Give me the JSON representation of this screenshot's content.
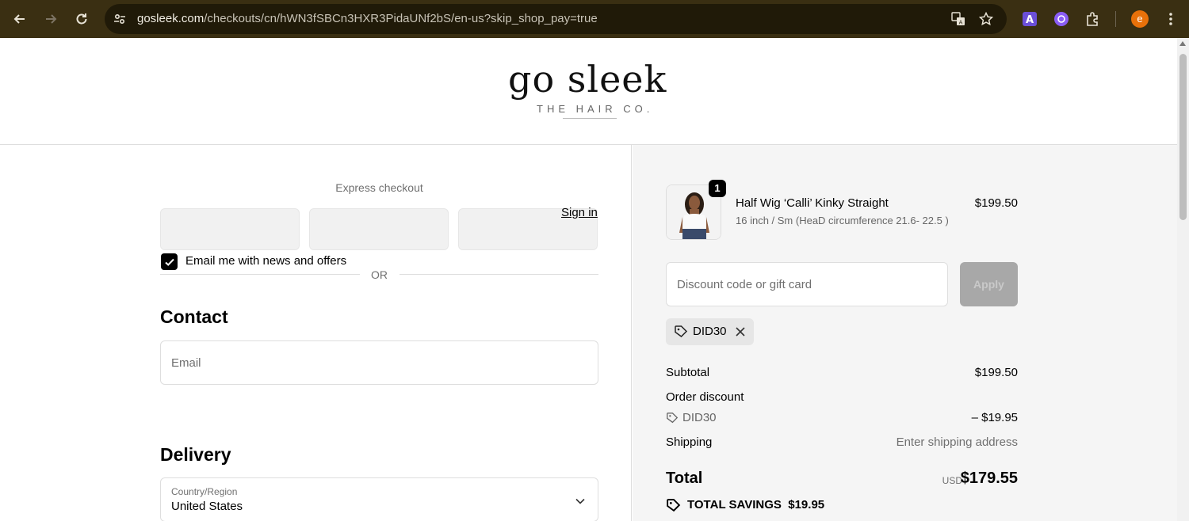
{
  "browser": {
    "url_host": "gosleek.com",
    "url_path": "/checkouts/cn/hWN3fSBCn3HXR3PidaUNf2bS/en-us?skip_shop_pay=true",
    "profile_initial": "e"
  },
  "header": {
    "logo_main": "go sleek",
    "logo_sub": "THE HAIR CO."
  },
  "checkout": {
    "express_title": "Express checkout",
    "or_text": "OR",
    "contact_heading": "Contact",
    "sign_in_label": "Sign in",
    "email_placeholder": "Email",
    "news_checkbox_label": "Email me with news and offers",
    "news_checked": true,
    "delivery_heading": "Delivery",
    "country_label": "Country/Region",
    "country_value": "United States"
  },
  "summary": {
    "product": {
      "quantity": "1",
      "name": "Half Wig ‘Calli’ Kinky Straight",
      "variant": "16 inch / Sm (HeaD circumference 21.6- 22.5 )",
      "price": "$199.50"
    },
    "discount_placeholder": "Discount code or gift card",
    "apply_label": "Apply",
    "applied_code": "DID30",
    "subtotal_label": "Subtotal",
    "subtotal_value": "$199.50",
    "order_discount_label": "Order discount",
    "discount_code": "DID30",
    "discount_value": "– $19.95",
    "shipping_label": "Shipping",
    "shipping_value": "Enter shipping address",
    "total_label": "Total",
    "total_currency": "USD",
    "total_value": "$179.55",
    "savings_label": "TOTAL SAVINGS",
    "savings_value": "$19.95"
  },
  "colors": {
    "chrome_bg": "#3a2f12",
    "profile_avatar": "#e8710a",
    "summary_bg": "#f5f5f5"
  }
}
